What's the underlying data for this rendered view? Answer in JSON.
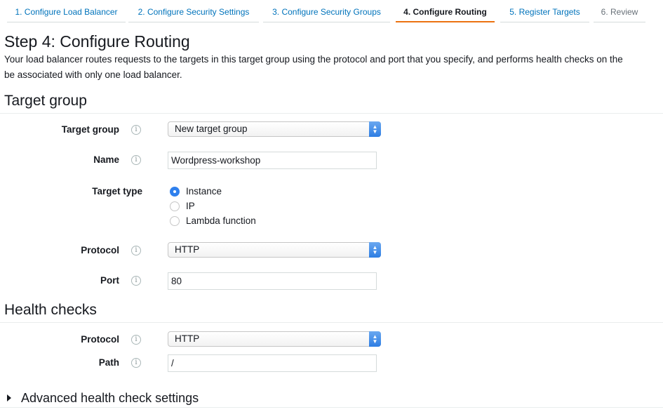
{
  "wizard": {
    "tabs": [
      {
        "label": "1. Configure Load Balancer",
        "state": "link"
      },
      {
        "label": "2. Configure Security Settings",
        "state": "link"
      },
      {
        "label": "3. Configure Security Groups",
        "state": "link"
      },
      {
        "label": "4. Configure Routing",
        "state": "active"
      },
      {
        "label": "5. Register Targets",
        "state": "link"
      },
      {
        "label": "6. Review",
        "state": "disabled"
      }
    ]
  },
  "header": {
    "title": "Step 4: Configure Routing",
    "description_line1": "Your load balancer routes requests to the targets in this target group using the protocol and port that you specify, and performs health checks on the",
    "description_line2": "be associated with only one load balancer."
  },
  "target_group_section": {
    "title": "Target group",
    "target_group": {
      "label": "Target group",
      "value": "New target group"
    },
    "name": {
      "label": "Name",
      "value": "Wordpress-workshop"
    },
    "target_type": {
      "label": "Target type",
      "options": [
        {
          "label": "Instance",
          "checked": true
        },
        {
          "label": "IP",
          "checked": false
        },
        {
          "label": "Lambda function",
          "checked": false
        }
      ]
    },
    "protocol": {
      "label": "Protocol",
      "value": "HTTP"
    },
    "port": {
      "label": "Port",
      "value": "80"
    }
  },
  "health_checks_section": {
    "title": "Health checks",
    "protocol": {
      "label": "Protocol",
      "value": "HTTP"
    },
    "path": {
      "label": "Path",
      "value": "/"
    },
    "advanced_label": "Advanced health check settings"
  },
  "icons": {
    "info": "i",
    "select_caret_up": "▲",
    "select_caret_down": "▼"
  },
  "colors": {
    "link": "#0073bb",
    "active_tab_underline": "#ec7211",
    "radio_checked": "#2f80ed",
    "select_caret": "#2d7de3"
  }
}
